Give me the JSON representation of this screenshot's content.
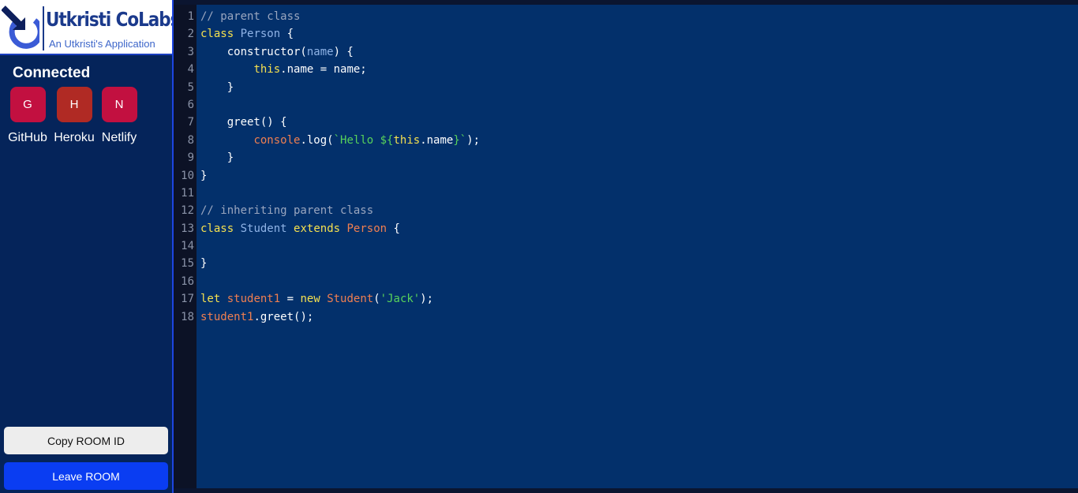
{
  "brand": {
    "title": "Utkristi CoLabs",
    "subtitle": "An Utkristi's Application"
  },
  "sidebar": {
    "connected_title": "Connected",
    "clients": [
      {
        "initial": "G",
        "name": "GitHub",
        "color": "#c21040"
      },
      {
        "initial": "H",
        "name": "Heroku",
        "color": "#b02a24"
      },
      {
        "initial": "N",
        "name": "Netlify",
        "color": "#c21040"
      }
    ],
    "copy_button": "Copy ROOM ID",
    "leave_button": "Leave ROOM"
  },
  "editor": {
    "lines": [
      {
        "n": "1",
        "tokens": [
          [
            "// parent class",
            "comment"
          ]
        ]
      },
      {
        "n": "2",
        "tokens": [
          [
            "class",
            "kw"
          ],
          [
            " ",
            "plain"
          ],
          [
            "Person",
            "type"
          ],
          [
            " {",
            "plain"
          ]
        ]
      },
      {
        "n": "3",
        "tokens": [
          [
            "    constructor(",
            "plain"
          ],
          [
            "name",
            "type"
          ],
          [
            ") {",
            "plain"
          ]
        ]
      },
      {
        "n": "4",
        "tokens": [
          [
            "        ",
            "plain"
          ],
          [
            "this",
            "kw"
          ],
          [
            ".name = name;",
            "plain"
          ]
        ]
      },
      {
        "n": "5",
        "tokens": [
          [
            "    }",
            "plain"
          ]
        ]
      },
      {
        "n": "6",
        "tokens": []
      },
      {
        "n": "7",
        "tokens": [
          [
            "    greet() {",
            "plain"
          ]
        ]
      },
      {
        "n": "8",
        "tokens": [
          [
            "        ",
            "plain"
          ],
          [
            "console",
            "var"
          ],
          [
            ".log(",
            "plain"
          ],
          [
            "`Hello ${",
            "str"
          ],
          [
            "this",
            "kw"
          ],
          [
            ".name",
            "plain"
          ],
          [
            "}`",
            "str"
          ],
          [
            ");",
            "plain"
          ]
        ]
      },
      {
        "n": "9",
        "tokens": [
          [
            "    }",
            "plain"
          ]
        ]
      },
      {
        "n": "10",
        "tokens": [
          [
            "}",
            "plain"
          ]
        ]
      },
      {
        "n": "11",
        "tokens": []
      },
      {
        "n": "12",
        "tokens": [
          [
            "// inheriting parent class",
            "comment"
          ]
        ]
      },
      {
        "n": "13",
        "tokens": [
          [
            "class",
            "kw"
          ],
          [
            " ",
            "plain"
          ],
          [
            "Student",
            "type"
          ],
          [
            " ",
            "plain"
          ],
          [
            "extends",
            "kw"
          ],
          [
            " ",
            "plain"
          ],
          [
            "Person",
            "var"
          ],
          [
            " {",
            "plain"
          ]
        ]
      },
      {
        "n": "14",
        "tokens": []
      },
      {
        "n": "15",
        "tokens": [
          [
            "}",
            "plain"
          ]
        ]
      },
      {
        "n": "16",
        "tokens": []
      },
      {
        "n": "17",
        "tokens": [
          [
            "let",
            "kw"
          ],
          [
            " ",
            "plain"
          ],
          [
            "student1",
            "var"
          ],
          [
            " = ",
            "plain"
          ],
          [
            "new",
            "kw"
          ],
          [
            " ",
            "plain"
          ],
          [
            "Student",
            "var"
          ],
          [
            "(",
            "plain"
          ],
          [
            "'Jack'",
            "str"
          ],
          [
            ");",
            "plain"
          ]
        ]
      },
      {
        "n": "18",
        "tokens": [
          [
            "student1",
            "var"
          ],
          [
            ".greet();",
            "plain"
          ]
        ]
      }
    ]
  }
}
